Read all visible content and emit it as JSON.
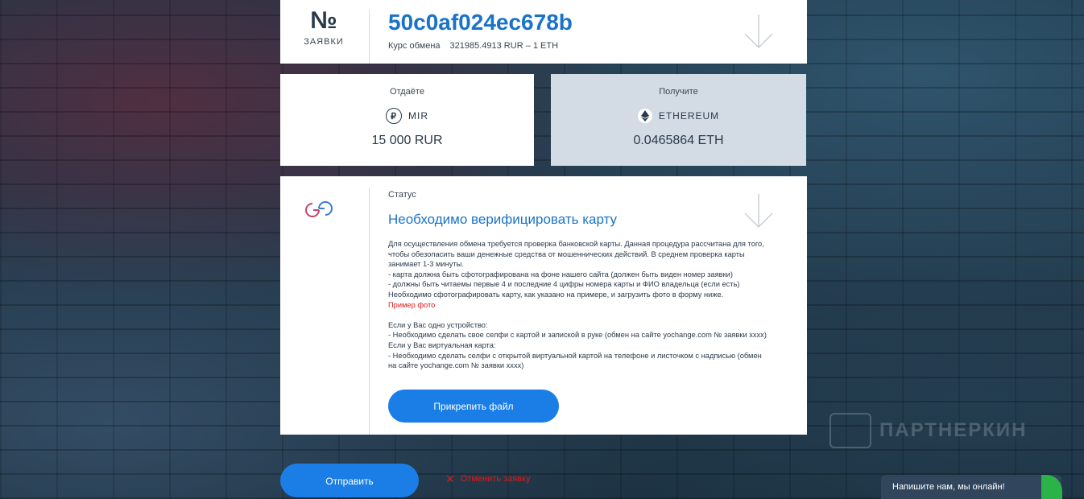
{
  "order": {
    "number_symbol": "№",
    "number_label": "ЗАЯВКИ",
    "id": "50c0af024ec678b",
    "rate_label": "Курс обмена",
    "rate_value": "321985.4913 RUR – 1 ETH"
  },
  "give": {
    "heading": "Отдаёте",
    "currency_icon": "mir-ruble-icon",
    "currency": "MIR",
    "amount": "15 000 RUR"
  },
  "get": {
    "heading": "Получите",
    "currency_icon": "ethereum-icon",
    "currency": "ETHEREUM",
    "amount": "0.0465864 ETH"
  },
  "status": {
    "label": "Статус",
    "title": "Необходимо верифицировать карту",
    "body": [
      "Для осуществления обмена требуется проверка банковской карты. Данная процедура рассчитана для того,",
      "чтобы обезопасить ваши денежные средства от мошеннических действий. В среднем проверка карты",
      "занимает 1-3 минуты.",
      "- карта должна быть сфотографирована на фоне нашего сайта (должен быть виден номер заявки)",
      "- должны быть читаемы первые 4 и последние 4 цифры номера карты и ФИО владельца (если есть)",
      "Необходимо сфотографировать карту, как указано на примере, и загрузить фото в форму ниже."
    ],
    "example_link": "Пример фото",
    "body2": [
      "Если у Вас одно устройство:",
      "- Необходимо сделать свое селфи с картой и запиской в руке (обмен на сайте yochange.com № заявки xxxx)",
      "Если у Вас виртуальная карта:",
      "- Необходимо сделать селфи с открытой виртуальной картой на телефоне и листочком с надписью (обмен",
      "на сайте yochange.com № заявки xxxx)"
    ],
    "attach_button": "Прикрепить файл"
  },
  "actions": {
    "send_button": "Отправить",
    "cancel_link": "Отменить заявку"
  },
  "watermark": "ПАРТНЕРКИН",
  "chat": {
    "label": "Напишите нам, мы онлайн!"
  },
  "colors": {
    "accent": "#1b7ee6",
    "title_blue": "#1a73c8",
    "danger": "#d81b1b",
    "get_card_bg": "#d3dce5",
    "online": "#2bb34a"
  }
}
